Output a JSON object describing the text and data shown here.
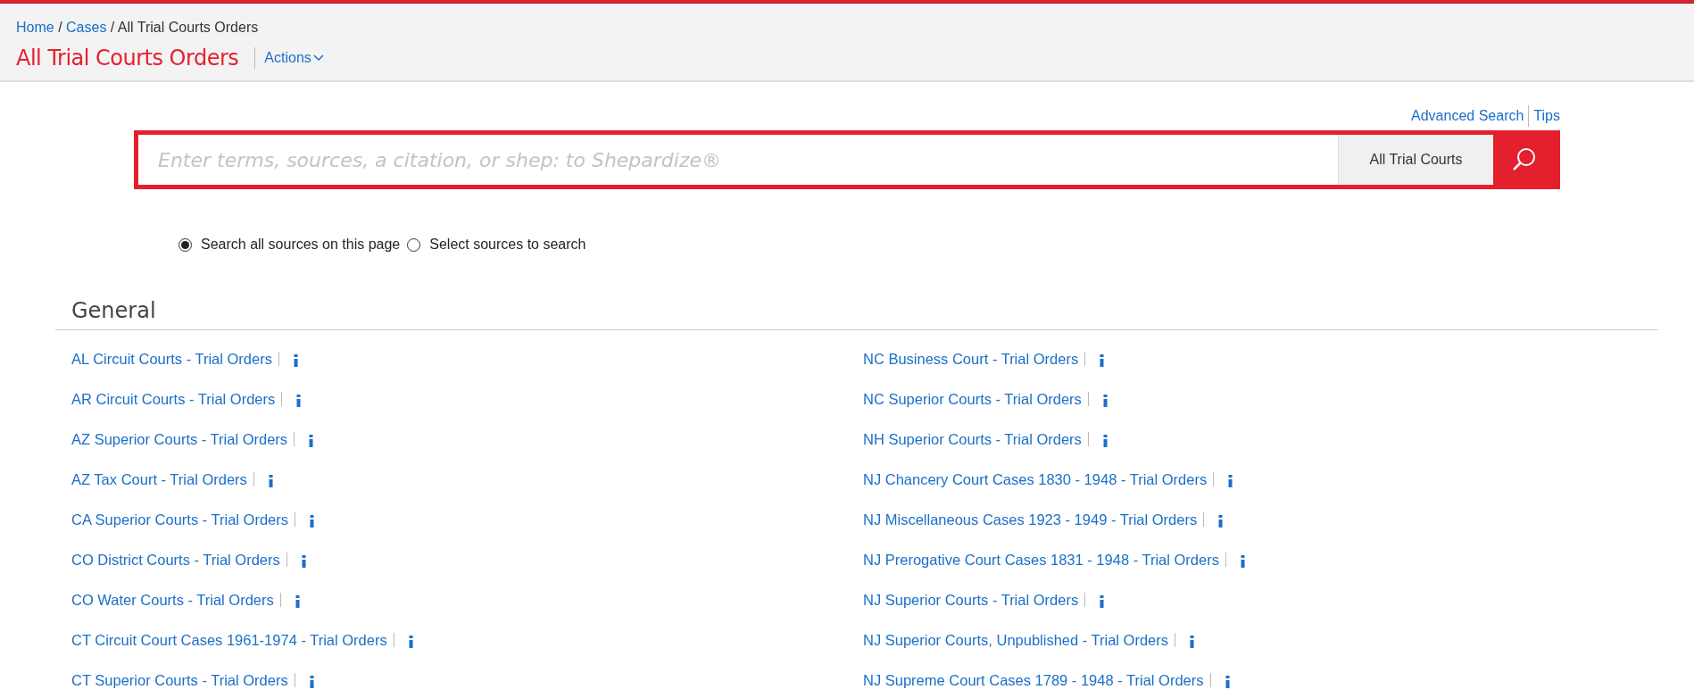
{
  "breadcrumb": [
    {
      "label": "Home",
      "link": true
    },
    {
      "label": "Cases",
      "link": true
    },
    {
      "label": "All Trial Courts Orders",
      "link": false
    }
  ],
  "breadcrumb_separator": "/",
  "page_title": "All Trial Courts Orders",
  "actions_menu": {
    "label": "Actions"
  },
  "search_links": [
    "Advanced Search",
    "Tips"
  ],
  "search": {
    "placeholder": "Enter terms, sources, a citation, or shep: to Shepardize®",
    "scope": "All Trial Courts"
  },
  "search_options": [
    {
      "label": "Search all sources on this page",
      "selected": true
    },
    {
      "label": "Select sources to search",
      "selected": false
    }
  ],
  "section": {
    "title": "General",
    "columns": [
      [
        "AL Circuit Courts - Trial Orders",
        "AR Circuit Courts - Trial Orders",
        "AZ Superior Courts - Trial Orders",
        "AZ Tax Court - Trial Orders",
        "CA Superior Courts - Trial Orders",
        "CO District Courts - Trial Orders",
        "CO Water Courts - Trial Orders",
        "CT Circuit Court Cases 1961-1974 - Trial Orders",
        "CT Superior Courts - Trial Orders"
      ],
      [
        "NC Business Court - Trial Orders",
        "NC Superior Courts - Trial Orders",
        "NH Superior Courts - Trial Orders",
        "NJ Chancery Court Cases 1830 - 1948 - Trial Orders",
        "NJ Miscellaneous Cases 1923 - 1949 - Trial Orders",
        "NJ Prerogative Court Cases 1831 - 1948 - Trial Orders",
        "NJ Superior Courts - Trial Orders",
        "NJ Superior Courts, Unpublished - Trial Orders",
        "NJ Supreme Court Cases 1789 - 1948 - Trial Orders"
      ]
    ]
  }
}
